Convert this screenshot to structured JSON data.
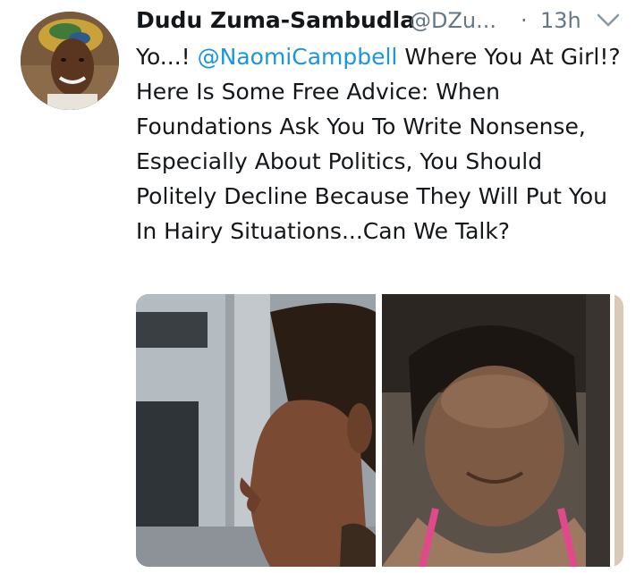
{
  "tweet": {
    "author": {
      "name": "Dudu Zuma-Sambudla",
      "handle": "@DZu...",
      "avatar_icon": "profile-photo"
    },
    "separator": "·",
    "timestamp": "13h",
    "menu_icon": "chevron-down-icon",
    "text": {
      "before": "Yo...! ",
      "mention": "@NaomiCampbell",
      "after": " Where You At Girl!? Here Is Some Free Advice: When Foundations Ask You To Write Nonsense, Especially About Politics, You Should Politely Decline Because They Will Put You In Hairy Situations...Can We Talk?"
    },
    "colors": {
      "name": "#14171a",
      "meta": "#657786",
      "mention": "#1b95e0",
      "chevron": "#8899a6"
    }
  }
}
